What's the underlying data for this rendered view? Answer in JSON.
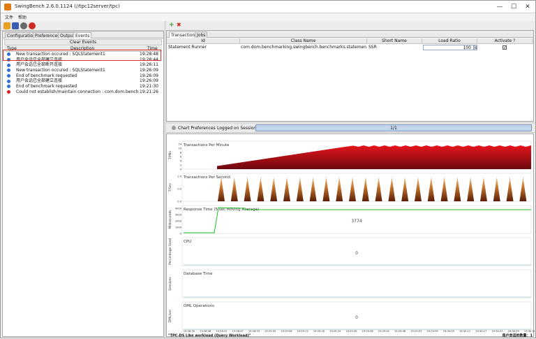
{
  "window": {
    "title": "SwingBench 2.6.0.1124  (//tpc12server/tpc)"
  },
  "menu": [
    "文件",
    "帮助"
  ],
  "left_tabs": [
    "Configuration",
    "Preferences",
    "Output",
    "Events"
  ],
  "events": {
    "clear_label": "Clear Events",
    "columns": {
      "type": "Type",
      "description": "Description",
      "time": "Time"
    },
    "rows": [
      {
        "type": "info",
        "description": "New transaction occured : SQLStatement1",
        "time": "19:28:48"
      },
      {
        "type": "info",
        "description": "用户会话已全部建立连接",
        "time": "19:28:44"
      },
      {
        "type": "info",
        "description": "用户会话已全部断开连接",
        "time": "19:26:11"
      },
      {
        "type": "info",
        "description": "New transaction occured : SQLStatement1",
        "time": "19:26:09"
      },
      {
        "type": "info",
        "description": "End of benchmark requested",
        "time": "19:26:09"
      },
      {
        "type": "info",
        "description": "用户会话已全部建立连接",
        "time": "19:26:09"
      },
      {
        "type": "info",
        "description": "End of benchmark requested",
        "time": "19:21:30"
      },
      {
        "type": "error",
        "description": "Could not establish/maintain connection : com.dom.benchmarking.s...",
        "time": "19:21:26"
      }
    ]
  },
  "right_tabs": [
    "Transactions",
    "Jobs"
  ],
  "transactions": {
    "columns": [
      "Id",
      "Class Name",
      "Short Name",
      "Load Ratio",
      "Activate ?"
    ],
    "rows": [
      {
        "id": "Statement Runner",
        "class_name": "com.dom.benchmarking.swingbench.benchmarks.statementrunner.SQL...",
        "short_name": "SSR",
        "load_ratio": "100",
        "activate": true
      }
    ]
  },
  "chart_bar": {
    "prefs_label": "Chart Preferences",
    "sessions_label": "Logged on Sessions",
    "sessions_value": "1/1"
  },
  "footer": {
    "workload": "\"TPC-DS Like workload (Query Workload)\"",
    "sessions_count": "用户会话的数量：1"
  },
  "chart_data": [
    {
      "type": "area",
      "title": "Transactions Per Minute",
      "ylabel": "T/Min",
      "yticks": [
        "0",
        "2",
        "4",
        "6",
        "8",
        "10",
        "14"
      ],
      "color": "#c8141c"
    },
    {
      "type": "area",
      "title": "Transactions Per Second",
      "ylabel": "T/Sec",
      "yticks": [
        "0.0",
        "0.5",
        "1.0"
      ],
      "color": "#a83a10"
    },
    {
      "type": "line",
      "title": "Response Time (5 sec Moving Average)",
      "ylabel": "Milliseconds",
      "yticks": [
        "0",
        "1000",
        "2000",
        "3000",
        "4000"
      ],
      "center_value": "3774",
      "color": "#1fc021"
    },
    {
      "type": "line",
      "title": "CPU",
      "ylabel": "Percentage Used",
      "center_value": "0"
    },
    {
      "type": "line",
      "title": "Database Time",
      "ylabel": "Sessions"
    },
    {
      "type": "line",
      "title": "DML Operations",
      "ylabel": "DML/sec",
      "center_value": "0"
    }
  ],
  "time_axis": [
    "19:28:35",
    "19:28:38",
    "19:28:41",
    "19:28:47",
    "19:28:53",
    "19:29:00",
    "19:29:06",
    "19:29:12",
    "19:29:18",
    "19:29:24",
    "19:29:30",
    "19:29:36",
    "19:29:42",
    "19:29:48",
    "19:29:53",
    "19:29:59",
    "19:30:05",
    "19:30:11",
    "19:30:17",
    "19:30:23",
    "19:30:29",
    "19:30:35"
  ],
  "colors": {
    "highlight": "#e0302a",
    "info_icon": "#2e6fd1",
    "error_icon": "#d3231c"
  }
}
